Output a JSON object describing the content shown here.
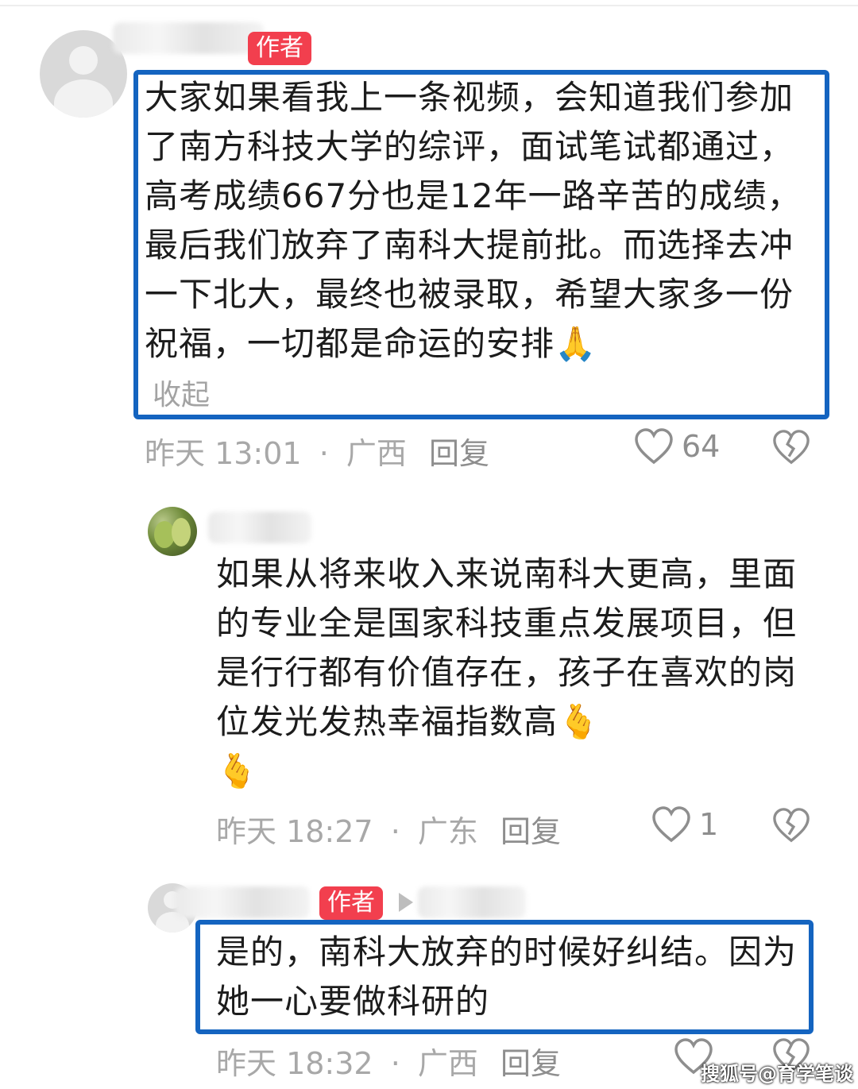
{
  "author_badge": "作者",
  "comment1": {
    "text": "大家如果看我上一条视频，会知道我们参加了南方科技大学的综评，面试笔试都通过，高考成绩667分也是12年一路辛苦的成绩，最后我们放弃了南科大提前批。而选择去冲一下北大，最终也被录取，希望大家多一份祝福，一切都是命运的安排",
    "emoji": "🙏",
    "collapse_label": "收起",
    "time": "昨天 13:01",
    "location": "广西",
    "reply_label": "回复",
    "likes": "64"
  },
  "comment2": {
    "text": "如果从将来收入来说南科大更高，里面的专业全是国家科技重点发展项目，但是行行都有价值存在，孩子在喜欢的岗位发光发热幸福指数高",
    "emoji1": "🫰",
    "emoji2": "🫰",
    "time": "昨天 18:27",
    "location": "广东",
    "reply_label": "回复",
    "likes": "1"
  },
  "comment3": {
    "text": "是的，南科大放弃的时候好纠结。因为她一心要做科研的",
    "time": "昨天 18:32",
    "location": "广西",
    "reply_label": "回复"
  },
  "separator": "·",
  "watermark": "搜狐号@育学笔谈",
  "colors": {
    "highlight_border": "#1464c0",
    "author_badge_bg": "#f23f4e",
    "meta_text": "#a8a8a8"
  },
  "icons": {
    "like": "heart-outline-icon",
    "dislike": "broken-heart-icon"
  }
}
